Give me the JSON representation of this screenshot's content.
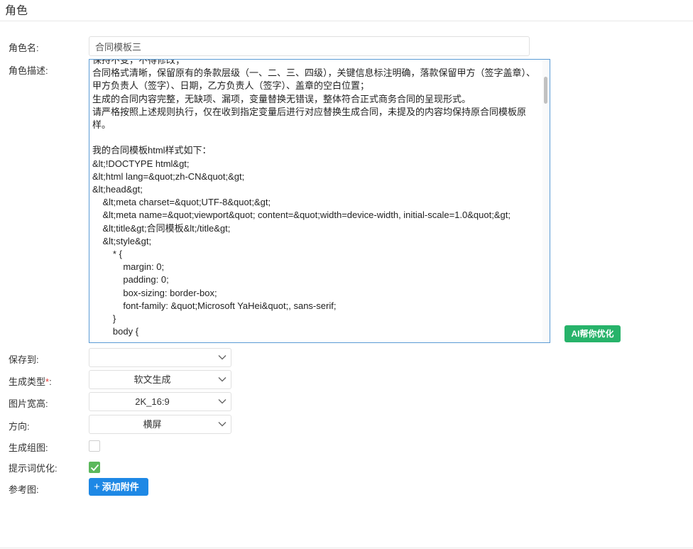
{
  "header": {
    "title": "角色"
  },
  "form": {
    "name_label": "角色名:",
    "name_value": "合同模板三",
    "desc_label": "角色描述:",
    "desc_text": "保持不变，不得修改；\n合同格式清晰，保留原有的条款层级（一、二、三、四级），关键信息标注明确，落款保留甲方（签字盖章）、甲方负责人（签字）、日期，乙方负责人（签字）、盖章的空白位置；\n生成的合同内容完整，无缺项、漏项，变量替换无错误，整体符合正式商务合同的呈现形式。\n请严格按照上述规则执行，仅在收到指定变量后进行对应替换生成合同，未提及的内容均保持原合同模板原样。\n\n我的合同模板html样式如下：\n&lt;!DOCTYPE html&gt;\n&lt;html lang=&quot;zh-CN&quot;&gt;\n&lt;head&gt;\n    &lt;meta charset=&quot;UTF-8&quot;&gt;\n    &lt;meta name=&quot;viewport&quot; content=&quot;width=device-width, initial-scale=1.0&quot;&gt;\n    &lt;title&gt;合同模板&lt;/title&gt;\n    &lt;style&gt;\n        * {\n            margin: 0;\n            padding: 0;\n            box-sizing: border-box;\n            font-family: &quot;Microsoft YaHei&quot;, sans-serif;\n        }\n        body {",
    "ai_button_label": "AI帮你优化",
    "save_to_label": "保存到:",
    "save_to_value": "",
    "gen_type_label": "生成类型",
    "required_mark": "*",
    "gen_type_colon": ":",
    "gen_type_value": "软文生成",
    "image_size_label": "图片宽高:",
    "image_size_value": "2K_16:9",
    "orientation_label": "方向:",
    "orientation_value": "横屏",
    "group_image_label": "生成组图:",
    "group_image_checked": false,
    "prompt_opt_label": "提示词优化:",
    "prompt_opt_checked": true,
    "reference_label": "参考图:",
    "attach_button_label": "添加附件"
  },
  "colors": {
    "ai_button": "#27b36a",
    "attach_button": "#1e88e5",
    "checkbox_checked": "#5cb85c",
    "focus_border": "#5b9bd5",
    "required": "#e53935"
  },
  "icons": {
    "select_arrow": "chevron-down-icon",
    "checkbox_mark": "check-icon",
    "attach": "plus-icon"
  }
}
